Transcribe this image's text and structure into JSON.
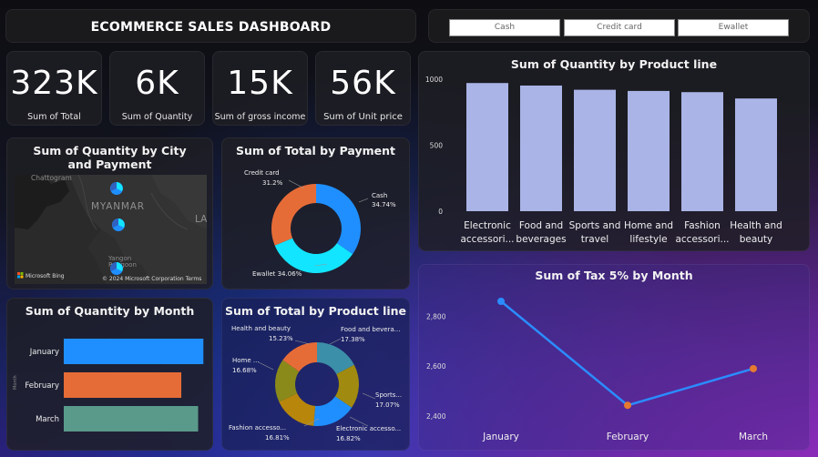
{
  "header": {
    "title": "ECOMMERCE SALES DASHBOARD"
  },
  "slicer": {
    "options": [
      "Cash",
      "Credit card",
      "Ewallet"
    ]
  },
  "kpis": [
    {
      "value": "323K",
      "label": "Sum of Total"
    },
    {
      "value": "6K",
      "label": "Sum of Quantity"
    },
    {
      "value": "15K",
      "label": "Sum of gross income"
    },
    {
      "value": "56K",
      "label": "Sum of Unit price"
    }
  ],
  "map": {
    "title": "Sum of Quantity by City and Payment",
    "labels": [
      "Chattogram",
      "MYANMAR",
      "LAO",
      "Yangon",
      "Rangoon"
    ],
    "attribution": "© 2024 Microsoft Corporation  Terms",
    "bing": "Microsoft Bing"
  },
  "colors": {
    "cash": "#1f8fff",
    "credit": "#e66c37",
    "ewallet": "#12e5ff",
    "bar": "#aab4e6",
    "line": "#2b8cff",
    "dot_orange": "#e67a30"
  },
  "chart_data": [
    {
      "type": "pie",
      "title": "Sum of Total by Payment",
      "categories": [
        "Cash",
        "Ewallet",
        "Credit card"
      ],
      "values": [
        34.74,
        34.06,
        31.2
      ],
      "labels": [
        "34.74%",
        "Ewallet 34.06%",
        "31.2%"
      ],
      "label_names": [
        "Cash",
        "",
        "Credit card"
      ],
      "colors": [
        "#1f8fff",
        "#12e5ff",
        "#e66c37"
      ]
    },
    {
      "type": "bar",
      "title": "Sum of Quantity by Product line",
      "categories": [
        "Electronic accessori...",
        "Food and beverages",
        "Sports and travel",
        "Home and lifestyle",
        "Fashion accessori...",
        "Health and beauty"
      ],
      "values": [
        971,
        952,
        920,
        911,
        902,
        854
      ],
      "yticks": [
        "1000",
        "500",
        "0"
      ],
      "ylim": [
        0,
        1000
      ]
    },
    {
      "type": "bar",
      "title": "Sum of Quantity by Month",
      "categories": [
        "January",
        "February",
        "March"
      ],
      "values": [
        1965,
        1654,
        1891
      ],
      "colors": [
        "#1f8fff",
        "#e66c37",
        "#5a9a8a"
      ],
      "xlim": [
        0,
        2000
      ]
    },
    {
      "type": "pie",
      "title": "Sum of Total by Product line",
      "categories": [
        "Food and beverages",
        "Sports and travel",
        "Electronic accessories",
        "Fashion accessories",
        "Home and lifestyle",
        "Health and beauty"
      ],
      "values": [
        17.38,
        17.07,
        16.82,
        16.81,
        16.68,
        15.23
      ],
      "label_names": [
        "Food and bevera...",
        "Sports...",
        "Electronic accesso...",
        "Fashion accesso...",
        "Home ...",
        "Health and beauty"
      ],
      "label_values": [
        "17.38%",
        "17.07%",
        "16.82%",
        "16.81%",
        "16.68%",
        "15.23%"
      ],
      "colors": [
        "#3c8fa8",
        "#a08a10",
        "#1f8fff",
        "#b8860b",
        "#8a8a1a",
        "#e66c37"
      ]
    },
    {
      "type": "line",
      "title": "Sum of Tax 5% by Month",
      "x": [
        "January",
        "February",
        "March"
      ],
      "y": [
        2860,
        2443,
        2590
      ],
      "yticks": [
        "2,800",
        "2,600",
        "2,400"
      ],
      "ylim": [
        2400,
        2860
      ],
      "point_colors": [
        "#2b8cff",
        "#e67a30",
        "#e67a30"
      ]
    }
  ]
}
